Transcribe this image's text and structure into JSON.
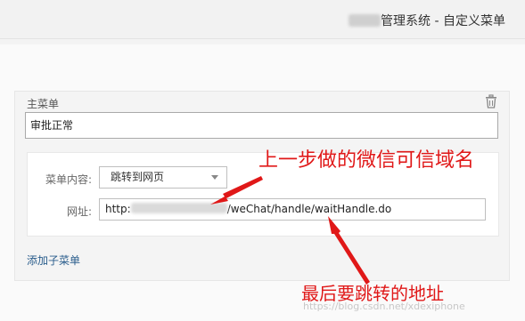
{
  "header": {
    "title": "管理系统 - 自定义菜单"
  },
  "menu": {
    "main_label": "主菜单",
    "main_name_value": "审批正常",
    "sub": {
      "content_label": "菜单内容:",
      "content_value": "跳转到网页",
      "url_label": "网址:",
      "url_prefix": "http:",
      "url_suffix": "/weChat/handle/waitHandle.do"
    },
    "add_sub_label": "添加子菜单"
  },
  "annotations": {
    "top": "上一步做的微信可信域名",
    "bottom": "最后要跳转的地址"
  },
  "watermark": "https://blog.csdn.net/xdexiphone",
  "colors": {
    "annotation": "#e01818",
    "link": "#2a5d8c"
  },
  "icons": {
    "delete": "trash-icon",
    "dropdown": "caret-down-icon"
  }
}
